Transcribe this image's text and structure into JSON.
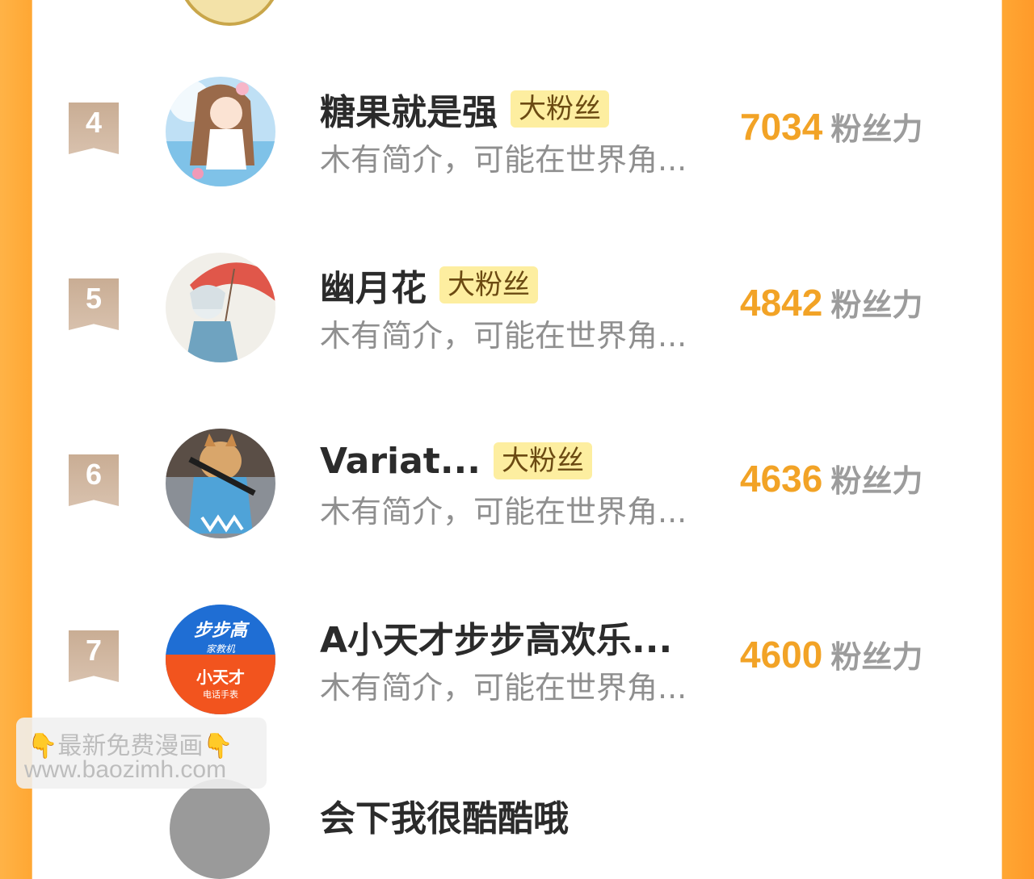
{
  "colors": {
    "accent": "#f2a326",
    "badge_bg": "#fdeea0",
    "side": "#ffa733"
  },
  "rows": [
    {
      "rank": "4",
      "name": "糖果就是强",
      "badge": "大粉丝",
      "desc": "木有简介，可能在世界角...",
      "score": "7034",
      "unit": "粉丝力",
      "avatar": "anime-girl-avatar"
    },
    {
      "rank": "5",
      "name": "幽月花",
      "badge": "大粉丝",
      "desc": "木有简介，可能在世界角...",
      "score": "4842",
      "unit": "粉丝力",
      "avatar": "umbrella-boy-avatar"
    },
    {
      "rank": "6",
      "name": "Variat...",
      "badge": "大粉丝",
      "desc": "木有简介，可能在世界角...",
      "score": "4636",
      "unit": "粉丝力",
      "avatar": "shiba-dog-avatar"
    },
    {
      "rank": "7",
      "name": "A小天才步步高欢乐...",
      "badge": "",
      "desc": "木有简介，可能在世界角...",
      "score": "4600",
      "unit": "粉丝力",
      "avatar": "bbk-logo-avatar",
      "logo_top": "步步高",
      "logo_top_sub": "家教机",
      "logo_bottom": "小天才",
      "logo_bottom_sub": "电话手表"
    }
  ],
  "partial_next_name": "会下我很酷酷哦",
  "watermark": {
    "line1": "最新免费漫画",
    "line2": "www.baozimh.com",
    "hand": "👇"
  }
}
